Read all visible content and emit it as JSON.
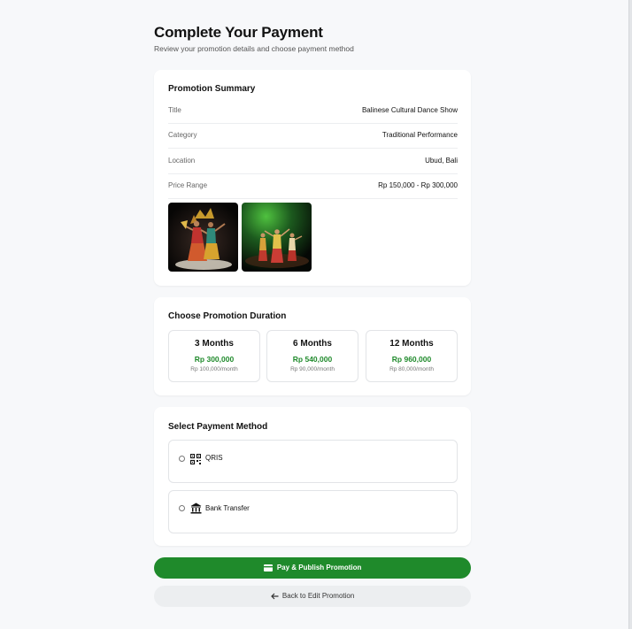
{
  "header": {
    "title": "Complete Your Payment",
    "subtitle": "Review your promotion details and choose payment method"
  },
  "summary": {
    "title": "Promotion Summary",
    "rows": [
      {
        "label": "Title",
        "value": "Balinese Cultural Dance Show"
      },
      {
        "label": "Category",
        "value": "Traditional Performance"
      },
      {
        "label": "Location",
        "value": "Ubud, Bali"
      },
      {
        "label": "Price Range",
        "value": "Rp 150,000 - Rp 300,000"
      }
    ],
    "images": [
      "balinese-dancers-photo",
      "stage-dancers-photo"
    ]
  },
  "duration": {
    "title": "Choose Promotion Duration",
    "options": [
      {
        "label": "3 Months",
        "price": "Rp 300,000",
        "per_month": "Rp 100,000/month"
      },
      {
        "label": "6 Months",
        "price": "Rp 540,000",
        "per_month": "Rp 90,000/month"
      },
      {
        "label": "12 Months",
        "price": "Rp 960,000",
        "per_month": "Rp 80,000/month"
      }
    ]
  },
  "payment": {
    "title": "Select Payment Method",
    "methods": [
      {
        "label": "QRIS",
        "icon": "qr-code-icon"
      },
      {
        "label": "Bank Transfer",
        "icon": "bank-icon"
      }
    ]
  },
  "actions": {
    "primary_label": "Pay & Publish Promotion",
    "primary_icon": "credit-card-icon",
    "secondary_label": "Back to Edit Promotion",
    "secondary_icon": "arrow-left-icon"
  },
  "colors": {
    "accent": "#1f8a2b",
    "background": "#f7f8fa"
  }
}
